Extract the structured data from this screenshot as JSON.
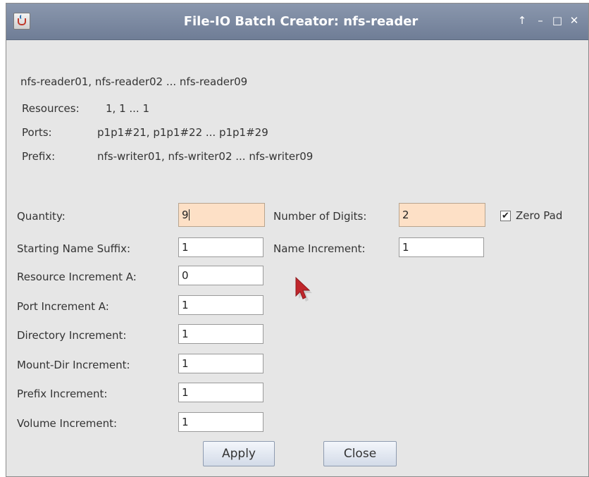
{
  "window": {
    "title": "File-IO Batch Creator: nfs-reader",
    "controls": [
      "↑",
      "–",
      "□",
      "✕"
    ]
  },
  "summary": {
    "names": "nfs-reader01, nfs-reader02 ... nfs-reader09",
    "resources_label": "Resources:",
    "resources_value": "1, 1 ... 1",
    "ports_label": "Ports:",
    "ports_value": "p1p1#21, p1p1#22 ... p1p1#29",
    "prefix_label": "Prefix:",
    "prefix_value": "nfs-writer01, nfs-writer02 ... nfs-writer09"
  },
  "form": {
    "quantity": {
      "label": "Quantity:",
      "value": "9"
    },
    "num_digits": {
      "label": "Number of Digits:",
      "value": "2"
    },
    "zero_pad": {
      "label": "Zero Pad",
      "checked": true
    },
    "start_suffix": {
      "label": "Starting Name Suffix:",
      "value": "1"
    },
    "name_increment": {
      "label": "Name Increment:",
      "value": "1"
    },
    "resource_increment": {
      "label": "Resource Increment A:",
      "value": "0"
    },
    "port_increment": {
      "label": "Port Increment A:",
      "value": "1"
    },
    "directory_increment": {
      "label": "Directory Increment:",
      "value": "1"
    },
    "mountdir_increment": {
      "label": "Mount-Dir Increment:",
      "value": "1"
    },
    "prefix_increment": {
      "label": "Prefix Increment:",
      "value": "1"
    },
    "volume_increment": {
      "label": "Volume Increment:",
      "value": "1"
    }
  },
  "buttons": {
    "apply": "Apply",
    "close": "Close"
  },
  "colors": {
    "titlebar": "#7b88a0",
    "highlight_field": "#fde0c6",
    "cursor": "#c0262b"
  },
  "icons": {
    "app": "java-cup-icon",
    "cursor": "mouse-pointer-icon"
  }
}
